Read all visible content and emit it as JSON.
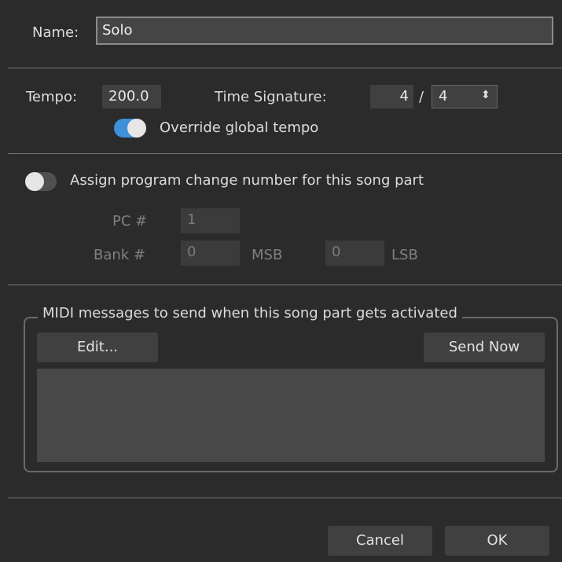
{
  "name": {
    "label": "Name:",
    "value": "Solo"
  },
  "tempo": {
    "label": "Tempo:",
    "value": "200.0",
    "time_signature_label": "Time Signature:",
    "numerator": "4",
    "slash": "/",
    "denominator": "4",
    "stepper_glyph": "⬍",
    "override_label": "Override global tempo",
    "override_enabled": true
  },
  "program_change": {
    "assign_label": "Assign program change number for this song part",
    "assign_enabled": false,
    "pc_label": "PC #",
    "pc_value": "1",
    "bank_label": "Bank #",
    "msb_value": "0",
    "msb_label": "MSB",
    "lsb_value": "0",
    "lsb_label": "LSB"
  },
  "midi": {
    "group_title": "MIDI messages to send when this song part gets activated",
    "edit_label": "Edit...",
    "send_now_label": "Send Now"
  },
  "footer": {
    "cancel_label": "Cancel",
    "ok_label": "OK"
  },
  "colors": {
    "toggle_on": "#3f8fd9",
    "toggle_off": "#505050",
    "background": "#2b2b2b"
  }
}
